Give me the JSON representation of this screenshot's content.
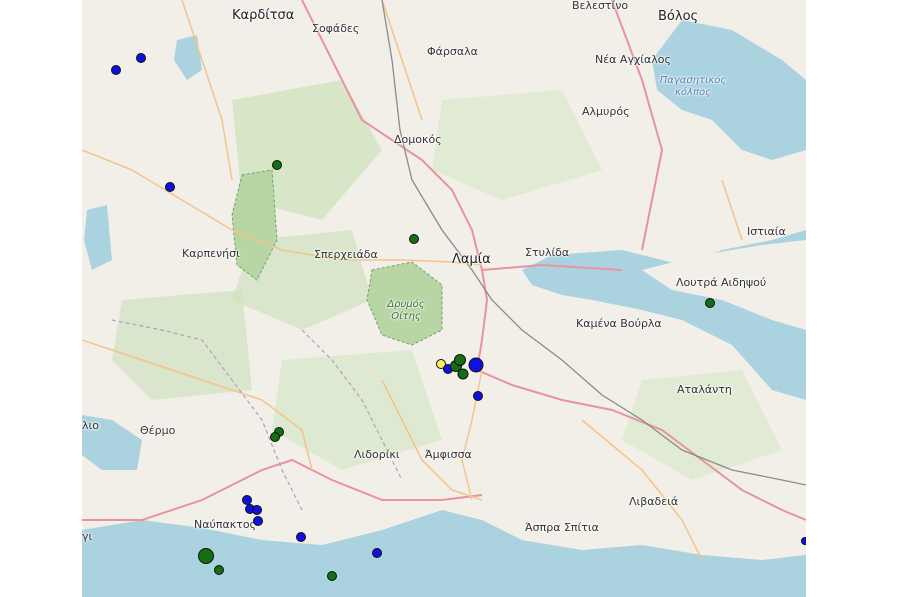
{
  "map": {
    "labels": {
      "karditsa": "Καρδίτσα",
      "sofades": "Σοφάδες",
      "farsala": "Φάρσαλα",
      "velestino": "Βελεστίνο",
      "volos": "Βόλος",
      "nea_anchialos": "Νέα Αγχίαλος",
      "pagasitikos": "Παγασητικός κόλπος",
      "almyros": "Αλμυρός",
      "domokos": "Δομοκός",
      "lamia": "Λαμία",
      "stylida": "Στυλίδα",
      "istiaia": "Ιστιαία",
      "karpenisi": "Καρπενήσι",
      "spercheiada": "Σπερχειάδα",
      "drymos_oitis": "Δρυμός Οίτης",
      "loutra_aidipsou": "Λουτρά Αιδηψού",
      "kamena_vourla": "Καμένα Βούρλα",
      "atalanti": "Αταλάντη",
      "thermo": "Θέρμο",
      "lio": "λιο",
      "lidoriki": "Λιδορίκι",
      "amfissa": "Άμφισσα",
      "livadeia": "Λιβαδειά",
      "nafpaktos": "Ναύπακτος",
      "aspra_spitia": "Άσπρα Σπίτια",
      "gi": "γι"
    },
    "colors": {
      "water": "#aad3df",
      "land": "#f2efe9",
      "forest": "#c8dfb6",
      "motorway": "#e892a2",
      "primary": "#fcd6a4",
      "rail": "#888888",
      "blue_marker": "#1010e0",
      "green_marker": "#127012",
      "yellow_marker": "#f6f05a"
    },
    "markers": [
      {
        "color": "blue",
        "size": 10
      },
      {
        "color": "blue",
        "size": 10
      },
      {
        "color": "blue",
        "size": 10
      },
      {
        "color": "green",
        "size": 10
      },
      {
        "color": "green",
        "size": 10
      },
      {
        "color": "green",
        "size": 10
      },
      {
        "color": "yellow",
        "size": 10
      },
      {
        "color": "blue",
        "size": 10
      },
      {
        "color": "green",
        "size": 12
      },
      {
        "color": "green",
        "size": 12
      },
      {
        "color": "blue",
        "size": 15
      },
      {
        "color": "green",
        "size": 11
      },
      {
        "color": "blue",
        "size": 10
      },
      {
        "color": "green",
        "size": 10
      },
      {
        "color": "green",
        "size": 10
      },
      {
        "color": "blue",
        "size": 10
      },
      {
        "color": "blue",
        "size": 10
      },
      {
        "color": "blue",
        "size": 10
      },
      {
        "color": "blue",
        "size": 10
      },
      {
        "color": "blue",
        "size": 10
      },
      {
        "color": "blue",
        "size": 10
      },
      {
        "color": "green",
        "size": 16
      },
      {
        "color": "green",
        "size": 10
      },
      {
        "color": "green",
        "size": 10
      },
      {
        "color": "blue",
        "size": 8
      }
    ]
  }
}
